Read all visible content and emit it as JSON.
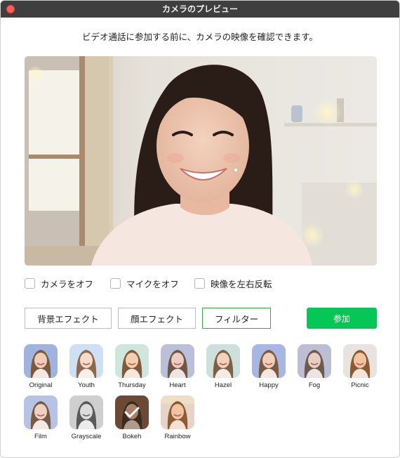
{
  "window": {
    "title": "カメラのプレビュー"
  },
  "intro": "ビデオ通話に参加する前に、カメラの映像を確認できます。",
  "options": [
    {
      "label": "カメラをオフ",
      "checked": false
    },
    {
      "label": "マイクをオフ",
      "checked": false
    },
    {
      "label": "映像を左右反転",
      "checked": false
    }
  ],
  "tabs": [
    {
      "label": "背景エフェクト",
      "active": false
    },
    {
      "label": "顔エフェクト",
      "active": false
    },
    {
      "label": "フィルター",
      "active": true
    }
  ],
  "join_label": "参加",
  "colors": {
    "accent": "#06c755",
    "titlebar": "#3f3f3f",
    "active_tab_border": "#2fae3c"
  },
  "filters": [
    {
      "label": "Original",
      "bg": "#9fb3de",
      "selected": false
    },
    {
      "label": "Youth",
      "bg": "#cfe0f5",
      "selected": false
    },
    {
      "label": "Thursday",
      "bg": "#cfe6dd",
      "selected": false
    },
    {
      "label": "Heart",
      "bg": "#b9c0d8",
      "selected": false
    },
    {
      "label": "Hazel",
      "bg": "#cde0dc",
      "selected": false
    },
    {
      "label": "Happy",
      "bg": "#a7b6e2",
      "selected": false
    },
    {
      "label": "Fog",
      "bg": "#bcbfd3",
      "selected": false
    },
    {
      "label": "Picnic",
      "bg": "#e9e3e0",
      "selected": false
    },
    {
      "label": "Film",
      "bg": "#b7c3e4",
      "selected": false
    },
    {
      "label": "Grayscale",
      "bg": "#cfcfcf",
      "selected": false
    },
    {
      "label": "Bokeh",
      "bg": "#6a4a35",
      "selected": true
    },
    {
      "label": "Rainbow",
      "bg": "#e7d3c8",
      "selected": false
    }
  ]
}
